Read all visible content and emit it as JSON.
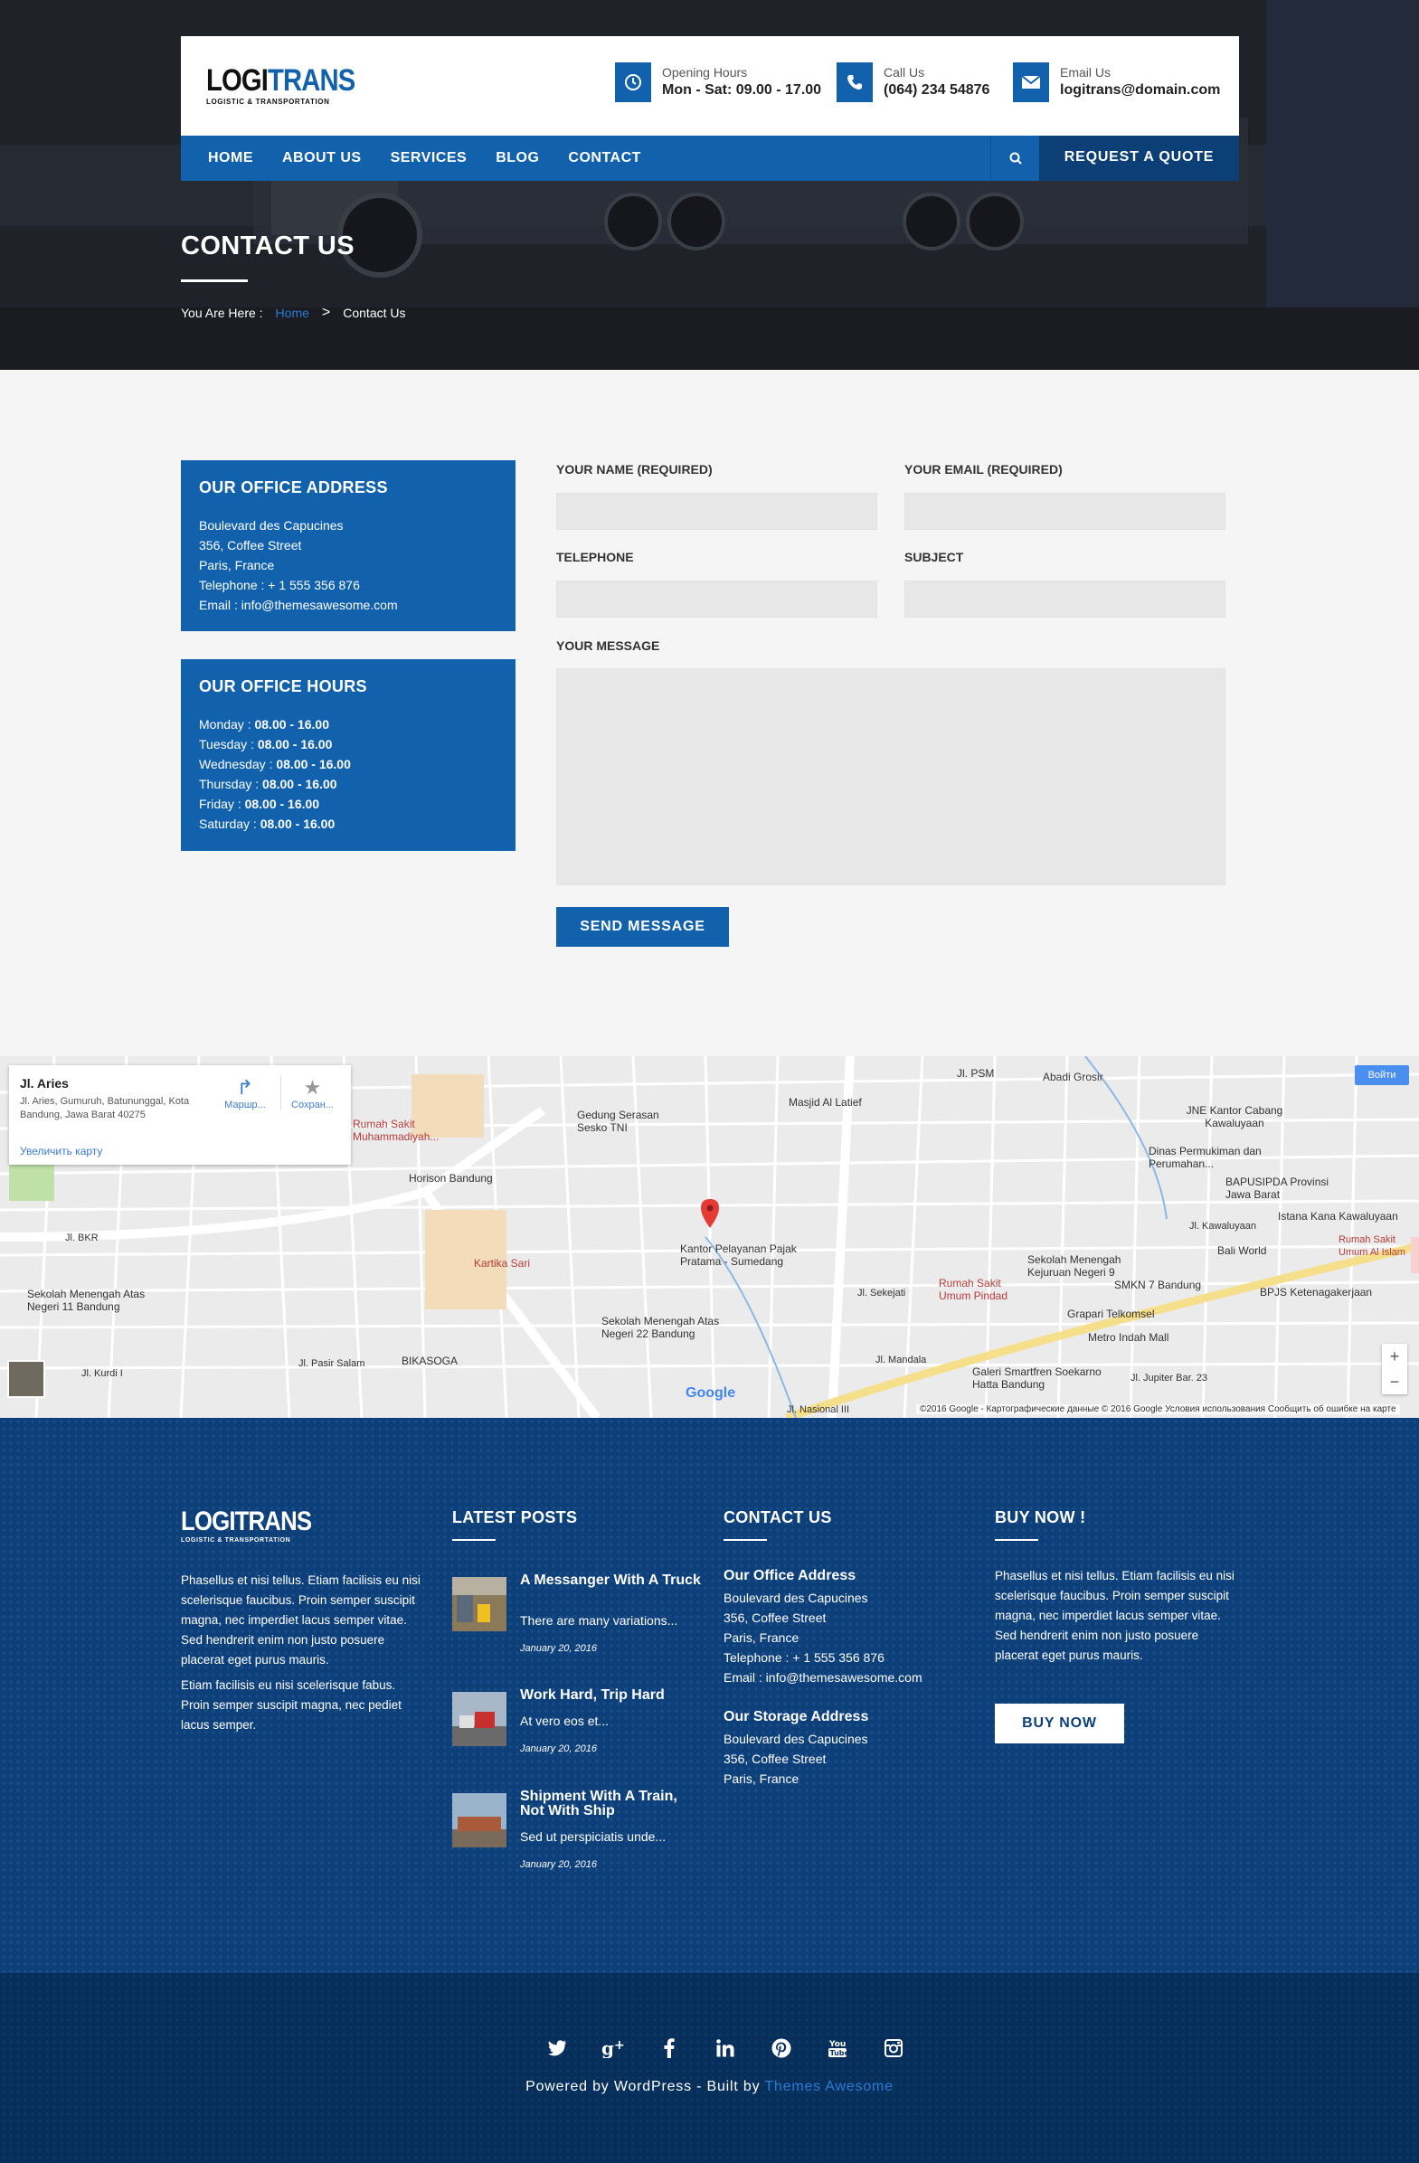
{
  "brand": {
    "logo_a": "LOGI",
    "logo_b": "TRANS",
    "tagline": "LOGISTIC & TRANSPORTATION",
    "accent": "#1261ad",
    "dark": "#0c3f75"
  },
  "topbar": {
    "hours": {
      "icon": "clock-icon",
      "label": "Opening Hours",
      "value": "Mon - Sat: 09.00 - 17.00"
    },
    "call": {
      "icon": "phone-icon",
      "label": "Call Us",
      "value": "(064) 234 54876"
    },
    "email": {
      "icon": "envelope-icon",
      "label": "Email Us",
      "value": "logitrans@domain.com"
    }
  },
  "nav": {
    "items": [
      "HOME",
      "ABOUT US",
      "SERVICES",
      "BLOG",
      "CONTACT"
    ],
    "search_icon": "search-icon",
    "quote": "REQUEST A QUOTE"
  },
  "hero": {
    "title": "CONTACT US",
    "breadcrumb_prefix": "You Are Here :",
    "breadcrumb_home": "Home",
    "breadcrumb_sep": ">",
    "breadcrumb_current": "Contact Us"
  },
  "office_address": {
    "title": "OUR OFFICE ADDRESS",
    "lines": [
      "Boulevard des Capucines",
      "356, Coffee Street",
      "Paris, France",
      "Telephone : + 1 555 356 876",
      "Email : info@themesawesome.com"
    ]
  },
  "office_hours": {
    "title": "OUR OFFICE HOURS",
    "rows": [
      {
        "day": "Monday :",
        "time": "08.00 - 16.00"
      },
      {
        "day": "Tuesday :",
        "time": "08.00 - 16.00"
      },
      {
        "day": "Wednesday :",
        "time": "08.00 - 16.00"
      },
      {
        "day": "Thursday :",
        "time": "08.00 - 16.00"
      },
      {
        "day": "Friday :",
        "time": "08.00 - 16.00"
      },
      {
        "day": "Saturday :",
        "time": "08.00 - 16.00"
      }
    ]
  },
  "form": {
    "name_label": "YOUR NAME (REQUIRED)",
    "email_label": "YOUR EMAIL (REQUIRED)",
    "phone_label": "TELEPHONE",
    "subject_label": "SUBJECT",
    "message_label": "YOUR MESSAGE",
    "name_value": "",
    "email_value": "",
    "phone_value": "",
    "subject_value": "",
    "message_value": "",
    "send": "SEND MESSAGE"
  },
  "map": {
    "card_title": "Jl. Aries",
    "card_address": "Jl. Aries, Gumuruh, Batununggal, Kota Bandung, Jawa Barat 40275",
    "card_enlarge": "Увеличить карту",
    "btn_route": "Маршр...",
    "btn_save": "Сохран...",
    "signin": "Войти",
    "google": "Google",
    "copyright": "©2016 Google - Картографические данные © 2016 Google    Условия использования    Сообщить об ошибке на карте",
    "labels": [
      {
        "t": "Jl. PSM",
        "c": ""
      },
      {
        "t": "Abadi Grosir",
        "c": ""
      },
      {
        "t": "Gedung Serasan Sesko TNI",
        "c": ""
      },
      {
        "t": "Masjid Al Latief",
        "c": ""
      },
      {
        "t": "JNE Kantor Cabang Kawaluyaan",
        "c": ""
      },
      {
        "t": "Rumah Sakit Muhammadiyah...",
        "c": "red"
      },
      {
        "t": "Dinas Permukiman dan Perumahan...",
        "c": ""
      },
      {
        "t": "Horison Bandung",
        "c": ""
      },
      {
        "t": "BAPUSIPDA Provinsi Jawa Barat",
        "c": ""
      },
      {
        "t": "Istana Kana Kawaluyaan",
        "c": ""
      },
      {
        "t": "Kantor Pelayanan Pajak Pratama - Sumedang",
        "c": ""
      },
      {
        "t": "Kartika Sari",
        "c": "red"
      },
      {
        "t": "Sekolah Menengah Kejuruan Negeri 9",
        "c": ""
      },
      {
        "t": "Bali World",
        "c": ""
      },
      {
        "t": "Rumah Sakit Umum Al Islam",
        "c": "red"
      },
      {
        "t": "SMKN 7 Bandung",
        "c": ""
      },
      {
        "t": "Rumah Sakit Umum Pindad",
        "c": "red"
      },
      {
        "t": "BPJS Ketenagakerjaan",
        "c": ""
      },
      {
        "t": "Sekolah Menengah Atas Negeri 11 Bandung",
        "c": ""
      },
      {
        "t": "Grapari Telkomsel",
        "c": ""
      },
      {
        "t": "Sekolah Menengah Atas Negeri 22 Bandung",
        "c": ""
      },
      {
        "t": "Metro Indah Mall",
        "c": ""
      },
      {
        "t": "BIKASOGA",
        "c": ""
      },
      {
        "t": "Galeri Smartfren Soekarno Hatta Bandung",
        "c": ""
      },
      {
        "t": "Jl. BKR",
        "c": ""
      },
      {
        "t": "Jl. Kurdi I",
        "c": ""
      },
      {
        "t": "Jl. Pasir Salam",
        "c": ""
      },
      {
        "t": "Jl. Mandala",
        "c": ""
      },
      {
        "t": "Jl. Sekejati",
        "c": ""
      },
      {
        "t": "Jl. Nasional III",
        "c": ""
      },
      {
        "t": "Jl. Jupiter Bar. 23",
        "c": ""
      },
      {
        "t": "Jl. Kawaluyaan",
        "c": ""
      }
    ]
  },
  "footer": {
    "about": [
      "Phasellus et nisi tellus. Etiam facilisis eu nisi scelerisque faucibus. Proin semper suscipit magna, nec imperdiet lacus semper vitae. Sed hendrerit enim non justo posuere placerat eget purus mauris.",
      "Etiam facilisis eu nisi scelerisque fabus. Proin semper suscipit magna, nec pediet lacus semper."
    ],
    "posts_title": "LATEST POSTS",
    "posts": [
      {
        "title": "A Messanger With A Truck",
        "excerpt": "There are many variations...",
        "date": "January 20, 2016"
      },
      {
        "title": "Work Hard, Trip Hard",
        "excerpt": "At vero eos et...",
        "date": "January 20, 2016"
      },
      {
        "title": "Shipment With A Train, Not With Ship",
        "excerpt": "Sed ut perspiciatis unde...",
        "date": "January 20, 2016"
      }
    ],
    "contact_title": "CONTACT US",
    "office_title": "Our Office Address",
    "office_lines": [
      "Boulevard des Capucines",
      "356, Coffee Street",
      "Paris, France",
      "Telephone : + 1 555 356 876",
      "Email : info@themesawesome.com"
    ],
    "storage_title": "Our Storage Address",
    "storage_lines": [
      "Boulevard des Capucines",
      "356, Coffee Street",
      "Paris, France"
    ],
    "buy_title": "BUY NOW !",
    "buy_text": "Phasellus et nisi tellus. Etiam facilisis eu nisi scelerisque faucibus. Proin semper suscipit magna, nec imperdiet lacus semper vitae. Sed hendrerit enim non justo posuere placerat eget purus mauris.",
    "buy_btn": "BUY NOW"
  },
  "bottom": {
    "social_icons": [
      "twitter-icon",
      "google-plus-icon",
      "facebook-icon",
      "linkedin-icon",
      "pinterest-icon",
      "youtube-icon",
      "instagram-icon"
    ],
    "powered": "Powered by WordPress - Built by",
    "themes": "Themes Awesome"
  }
}
